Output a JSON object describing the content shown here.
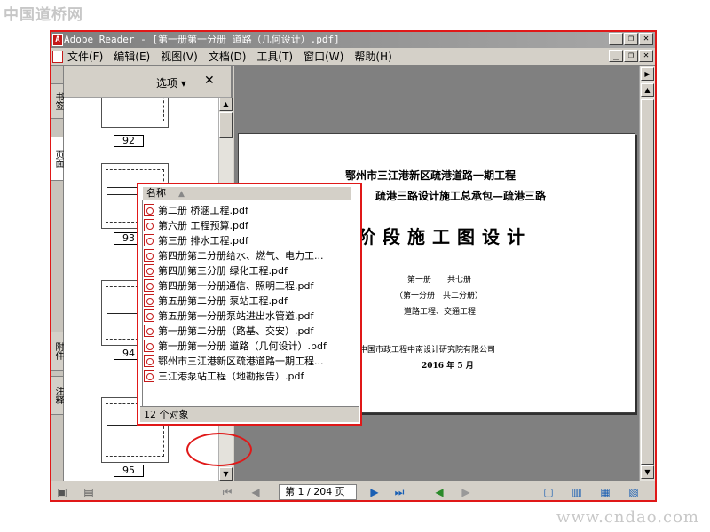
{
  "watermark_top": "中国道桥网",
  "watermark_bottom": "www.cndao.com",
  "window": {
    "title": "Adobe Reader - [第一册第一分册 道路（几何设计）.pdf]",
    "minimize": "_",
    "restore": "❐",
    "close": "✕"
  },
  "menu": [
    "文件(F)",
    "编辑(E)",
    "视图(V)",
    "文档(D)",
    "工具(T)",
    "窗口(W)",
    "帮助(H)"
  ],
  "left_tabs": [
    "书签",
    "页面",
    "附件",
    "注释"
  ],
  "panel": {
    "options_label": "选项 ▾",
    "close_label": "✕",
    "thumbnails": [
      "92",
      "93",
      "94",
      "95"
    ]
  },
  "page_content": {
    "title1": "鄂州市三江港新区疏港道路一期工程",
    "title2": "疏港三路设计施工总承包—疏港三路",
    "big_title": "阶段施工图设计",
    "volume": "第一册　　共七册",
    "sub_volume": "（第一分册　共二分册）",
    "work": "道路工程、交通工程",
    "institute": "中国市政工程中南设计研究院有限公司",
    "date": "2016 年 5 月"
  },
  "popup": {
    "column_header": "名称",
    "files": [
      "第二册 桥涵工程.pdf",
      "第六册 工程预算.pdf",
      "第三册 排水工程.pdf",
      "第四册第二分册给水、燃气、电力工...",
      "第四册第三分册 绿化工程.pdf",
      "第四册第一分册通信、照明工程.pdf",
      "第五册第二分册  泵站工程.pdf",
      "第五册第一分册泵站进出水管道.pdf",
      "第一册第二分册（路基、交安）.pdf",
      "第一册第一分册 道路（几何设计）.pdf",
      "鄂州市三江港新区疏港道路一期工程...",
      "三江港泵站工程（地勘报告）.pdf"
    ],
    "status": "12 个对象"
  },
  "nav": {
    "page_display": "第 1 / 204 页"
  }
}
